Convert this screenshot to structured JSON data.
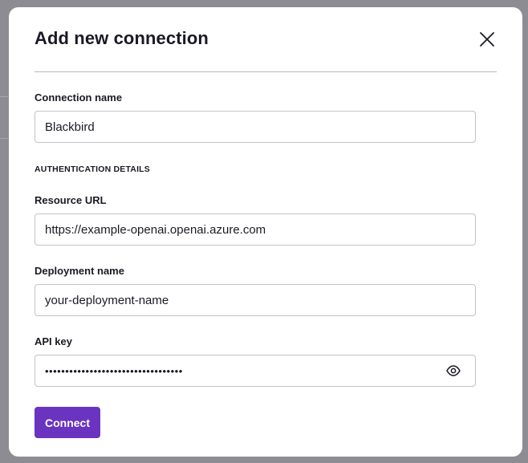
{
  "dialog": {
    "title": "Add new connection",
    "close_icon": "close-icon"
  },
  "form": {
    "connection_name": {
      "label": "Connection name",
      "value": "Blackbird"
    },
    "section_label": "AUTHENTICATION DETAILS",
    "resource_url": {
      "label": "Resource URL",
      "value": "https://example-openai.openai.azure.com"
    },
    "deployment_name": {
      "label": "Deployment name",
      "value": "your-deployment-name"
    },
    "api_key": {
      "label": "API key",
      "value": "••••••••••••••••••••••••••••••••••",
      "reveal_icon": "eye-icon"
    }
  },
  "actions": {
    "connect_label": "Connect"
  },
  "colors": {
    "accent": "#6a33c0",
    "text": "#1b1a24",
    "border": "#c3c2c7",
    "overlay": "#8e8c93"
  }
}
